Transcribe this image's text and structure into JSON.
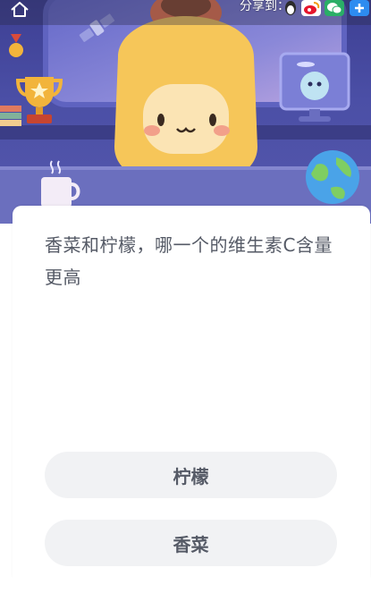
{
  "top_bar": {
    "share_label": "分享到：",
    "home_icon": "home-icon",
    "share_targets": [
      {
        "name": "qq-share",
        "icon": "qq-penguin-icon"
      },
      {
        "name": "weibo-share",
        "icon": "weibo-icon",
        "color": "#e6162d"
      },
      {
        "name": "wechat-share",
        "icon": "wechat-icon",
        "color": "#2aae67"
      },
      {
        "name": "more-share",
        "icon": "plus-icon",
        "color": "#2d8cf0"
      }
    ]
  },
  "colors": {
    "hero_background": "#4b4fa6",
    "card_background": "#ffffff",
    "option_background": "#f1f2f4",
    "text": "#555a66"
  },
  "quiz": {
    "question": "香菜和柠檬，哪一个的维生素C含量更高",
    "options": [
      {
        "label": "柠檬"
      },
      {
        "label": "香菜"
      }
    ]
  }
}
